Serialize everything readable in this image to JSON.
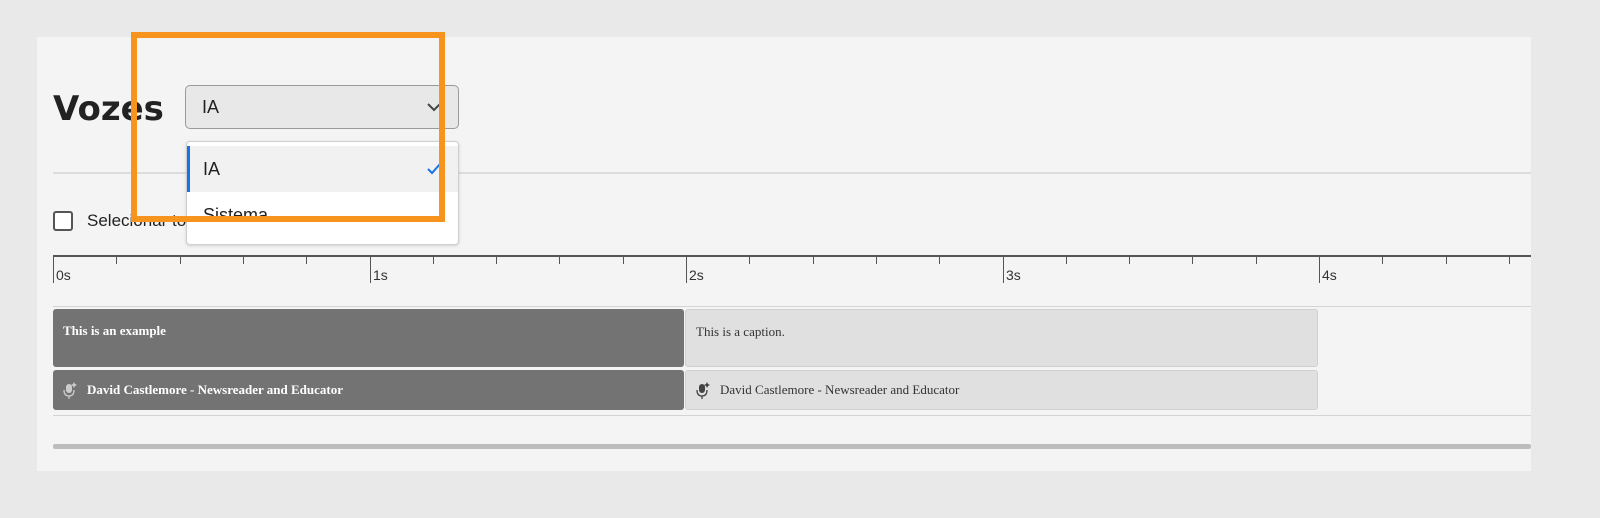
{
  "panel": {
    "title": "Vozes",
    "select_all_label": "Selecionar todos"
  },
  "dropdown": {
    "value": "IA",
    "options": [
      {
        "label": "IA",
        "selected": true
      },
      {
        "label": "Sistema",
        "selected": false
      }
    ],
    "icons": {
      "trigger": "chevron-down-icon",
      "selected": "checkmark-icon"
    }
  },
  "timeline": {
    "ticks": [
      "0s",
      "1s",
      "2s",
      "3s",
      "4s"
    ],
    "clips": [
      {
        "caption": "This is an example",
        "voice": "David Castlemore - Newsreader and Educator",
        "style": "selected"
      },
      {
        "caption": "This is a caption.",
        "voice": "David Castlemore - Newsreader and Educator",
        "style": "default"
      }
    ]
  },
  "colors": {
    "highlight": "#f7941d",
    "selected_clip": "#737373",
    "default_clip": "#e0e0e0",
    "accent": "#1473e6"
  }
}
